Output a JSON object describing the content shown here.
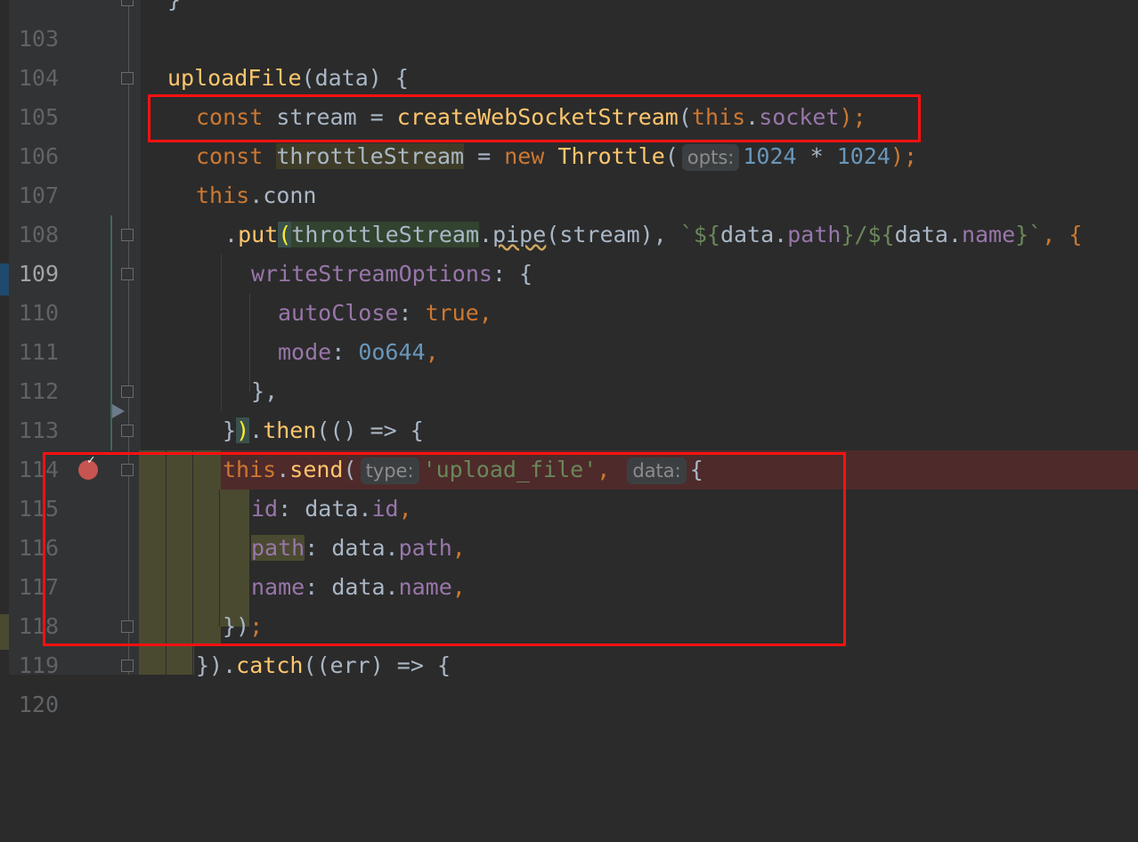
{
  "colors": {
    "background": "#2b2b2b",
    "gutter": "#313335",
    "keyword": "#cc7832",
    "function": "#ffc66d",
    "property": "#9876aa",
    "number": "#6897bb",
    "string": "#6a8759",
    "default_text": "#a9b7c6",
    "annotation_box": "#ff1010",
    "breakpoint": "#c75450"
  },
  "editor": {
    "lines": [
      {
        "num": "103",
        "text": "}"
      },
      {
        "num": "104",
        "text": ""
      },
      {
        "num": "105",
        "fn": "uploadFile",
        "args": "(data) {"
      },
      {
        "num": "106",
        "kw": "const",
        "var": " stream = ",
        "fn": "createWebSocketStream",
        "open": "(",
        "this": "this",
        "dot": ".",
        "prop": "socket",
        "close": ");"
      },
      {
        "num": "107",
        "kw": "const",
        "var": "throttleStream",
        "eq": " = ",
        "kw2": "new",
        "cls": "Throttle",
        "open": "(",
        "hint": "opts:",
        "n1": "1024",
        "op": " * ",
        "n2": "1024",
        "close": ");"
      },
      {
        "num": "108",
        "this": "this",
        "rest": ".conn"
      },
      {
        "num": "109",
        "dot": ".",
        "fn": "put",
        "paren": "(",
        "var": "throttleStream",
        "dot2": ".",
        "method": "pipe",
        "args": "(stream), ",
        "tpl_open": "`${",
        "tpl_obj1": "data",
        "tpl_dot1": ".",
        "tpl_prop1": "path",
        "tpl_mid": "}/${",
        "tpl_obj2": "data",
        "tpl_dot2": ".",
        "tpl_prop2": "name",
        "tpl_close": "}`",
        "tail": ", {"
      },
      {
        "num": "110",
        "prop": "writeStreamOptions",
        "rest": ": {"
      },
      {
        "num": "111",
        "prop": "autoClose",
        "colon": ": ",
        "val": "true",
        "comma": ","
      },
      {
        "num": "112",
        "prop": "mode",
        "colon": ": ",
        "val": "0o644",
        "comma": ","
      },
      {
        "num": "113",
        "text": "},"
      },
      {
        "num": "114",
        "brace": "}",
        "paren": ")",
        "dot": ".",
        "fn": "then",
        "rest": "(() => {"
      },
      {
        "num": "115",
        "this": "this",
        "dot": ".",
        "fn": "send",
        "open": "(",
        "hint1": "type:",
        "str": "'upload_file'",
        "comma": ",",
        "hint2": "data:",
        "rest": "{"
      },
      {
        "num": "116",
        "prop": "id",
        "colon": ": data.",
        "prop2": "id",
        "comma": ","
      },
      {
        "num": "117",
        "prop": "path",
        "colon": ": data.",
        "prop2": "path",
        "comma": ","
      },
      {
        "num": "118",
        "prop": "name",
        "colon": ": data.",
        "prop2": "name",
        "comma": ","
      },
      {
        "num": "119",
        "text": "})",
        "semi": ";"
      },
      {
        "num": "120",
        "brace": "})",
        "dot": ".",
        "fn": "catch",
        "rest": "((err) => {"
      }
    ]
  }
}
